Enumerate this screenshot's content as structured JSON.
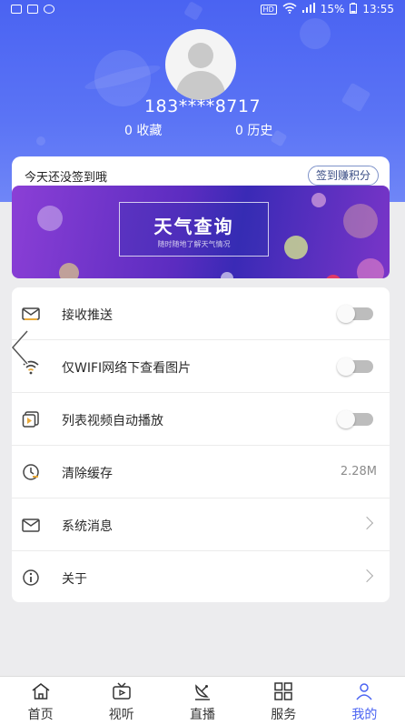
{
  "status_bar": {
    "battery": "15%",
    "time": "13:55",
    "hd": "HD"
  },
  "user": {
    "phone": "183****8717",
    "favorites": "0 收藏",
    "history": "0 历史"
  },
  "sign_in": {
    "prompt": "今天还没签到哦",
    "button": "签到赚积分"
  },
  "banner": {
    "title": "天气查询",
    "subtitle": "随时随地了解天气情况"
  },
  "settings": [
    {
      "label": "接收推送",
      "type": "toggle",
      "icon": "mail-push-icon",
      "on": false
    },
    {
      "label": "仅WIFI网络下查看图片",
      "type": "toggle",
      "icon": "wifi-icon",
      "on": false
    },
    {
      "label": "列表视频自动播放",
      "type": "toggle",
      "icon": "video-play-icon",
      "on": false
    },
    {
      "label": "清除缓存",
      "type": "value",
      "icon": "clock-clear-icon",
      "value": "2.28M"
    },
    {
      "label": "系统消息",
      "type": "chevron",
      "icon": "envelope-icon"
    },
    {
      "label": "关于",
      "type": "chevron",
      "icon": "info-icon"
    }
  ],
  "tabs": [
    {
      "label": "首页",
      "icon": "home-icon"
    },
    {
      "label": "视听",
      "icon": "tv-icon"
    },
    {
      "label": "直播",
      "icon": "satellite-dish-icon"
    },
    {
      "label": "服务",
      "icon": "grid-icon"
    },
    {
      "label": "我的",
      "icon": "person-icon",
      "active": true
    }
  ],
  "colors": {
    "primary": "#4a63f2",
    "banner": "#5b2cc0"
  }
}
